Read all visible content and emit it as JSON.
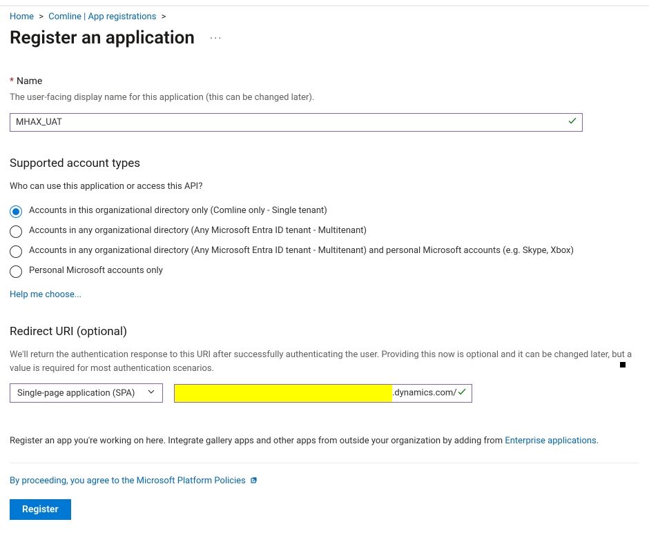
{
  "breadcrumb": {
    "home": "Home",
    "appreg": "Comline | App registrations"
  },
  "page_title": "Register an application",
  "name_section": {
    "label": "Name",
    "help": "The user-facing display name for this application (this can be changed later).",
    "value": "MHAX_UAT"
  },
  "account_types": {
    "heading": "Supported account types",
    "question": "Who can use this application or access this API?",
    "options": [
      "Accounts in this organizational directory only (Comline only - Single tenant)",
      "Accounts in any organizational directory (Any Microsoft Entra ID tenant - Multitenant)",
      "Accounts in any organizational directory (Any Microsoft Entra ID tenant - Multitenant) and personal Microsoft accounts (e.g. Skype, Xbox)",
      "Personal Microsoft accounts only"
    ],
    "selected_index": 0,
    "help_link": "Help me choose..."
  },
  "redirect": {
    "heading": "Redirect URI (optional)",
    "help": "We'll return the authentication response to this URI after successfully authenticating the user. Providing this now is optional and it can be changed later, but a value is required for most authentication scenarios.",
    "platform_selected": "Single-page application (SPA)",
    "uri_visible_suffix": ".dynamics.com/"
  },
  "gallery_note_prefix": "Register an app you're working on here. Integrate gallery apps and other apps from outside your organization by adding from ",
  "gallery_link": "Enterprise applications",
  "policy_prefix": "By proceeding, you agree to the ",
  "policy_link": "Microsoft Platform Policies",
  "register_label": "Register"
}
